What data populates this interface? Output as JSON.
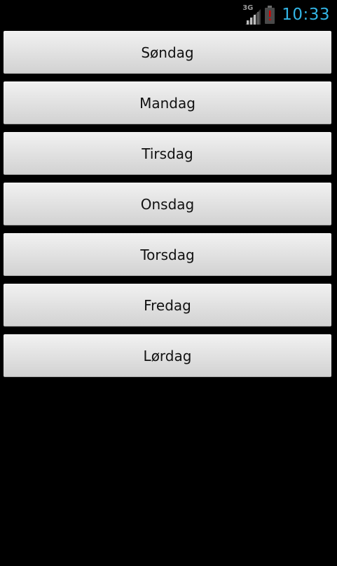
{
  "status_bar": {
    "network": "3G",
    "time": "10:33",
    "signal_icon": "signal-strength-icon",
    "battery_icon": "battery-alert-icon",
    "time_color": "#33b5e5",
    "battery_alert_color": "#cc0000"
  },
  "days": [
    {
      "label": "Søndag"
    },
    {
      "label": "Mandag"
    },
    {
      "label": "Tirsdag"
    },
    {
      "label": "Onsdag"
    },
    {
      "label": "Torsdag"
    },
    {
      "label": "Fredag"
    },
    {
      "label": "Lørdag"
    }
  ]
}
